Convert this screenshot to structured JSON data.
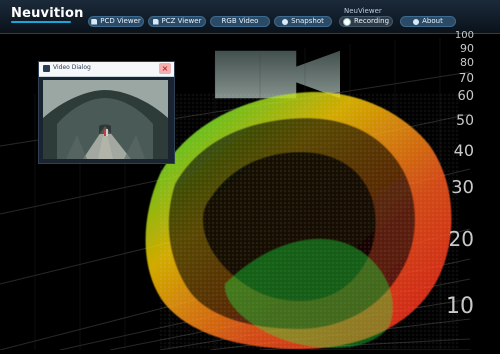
{
  "app": {
    "brand": "Neuvition",
    "title": "NeuViewer"
  },
  "nav": [
    {
      "label": "PCD Viewer",
      "icon": "file-icon"
    },
    {
      "label": "PCZ Viewer",
      "icon": "file-icon"
    },
    {
      "label": "RGB Video",
      "icon": "video-icon"
    },
    {
      "label": "Snapshot",
      "icon": "camera-icon"
    },
    {
      "label": "Recording",
      "icon": "record-icon"
    },
    {
      "label": "About",
      "icon": "info-icon"
    }
  ],
  "scale": {
    "labels": [
      "100",
      "90",
      "80",
      "70",
      "60",
      "50",
      "40",
      "30",
      "20",
      "10"
    ]
  },
  "dialog": {
    "title": "Video Dialog",
    "close": "×"
  },
  "colors": {
    "bar_bg": "#0a121a",
    "button": "#2b4a66",
    "accent": "#1aa6d8",
    "cloud_near": "#ff2a2a",
    "cloud_mid": "#ffd000",
    "cloud_far": "#19ff3f"
  }
}
